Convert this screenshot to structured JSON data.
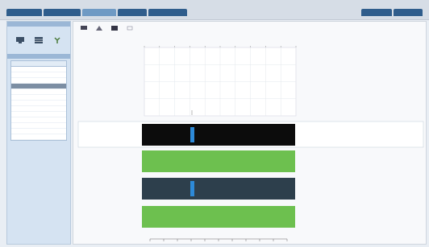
{
  "topbar": {
    "tabs": [
      "",
      "",
      "",
      "",
      ""
    ],
    "right_tabs": [
      "",
      ""
    ]
  },
  "sidebar": {
    "tools_header": "",
    "tools": [
      {
        "icon": "monitor-icon",
        "label": ""
      },
      {
        "icon": "grid-icon",
        "label": ""
      },
      {
        "icon": "tree-icon",
        "label": ""
      }
    ],
    "list_header": "",
    "table_headers": [
      "",
      ""
    ],
    "rows": [
      [
        "",
        ""
      ],
      [
        "",
        ""
      ],
      [
        "",
        ""
      ],
      [
        "",
        ""
      ],
      [
        "",
        ""
      ],
      [
        "",
        ""
      ],
      [
        "",
        ""
      ],
      [
        "",
        ""
      ],
      [
        "",
        ""
      ],
      [
        "",
        ""
      ],
      [
        "",
        ""
      ],
      [
        "",
        ""
      ],
      [
        "",
        ""
      ]
    ],
    "selected_row": 3
  },
  "main": {
    "toolbar": [
      {
        "icon": "display-icon",
        "label": ""
      },
      {
        "icon": "triangle-icon",
        "label": ""
      },
      {
        "icon": "chart-icon",
        "label": ""
      },
      {
        "icon": "options-icon",
        "label": ""
      }
    ],
    "lanes": [
      {
        "label": "",
        "color": "#0c0c0c",
        "marker": true
      },
      {
        "label": "",
        "color": "#6dc04f",
        "marker": false
      },
      {
        "label": "",
        "color": "#2d3f4c",
        "marker": true
      },
      {
        "label": "",
        "color": "#6dc04f",
        "marker": false
      }
    ],
    "marker_color": "#2d8ad8",
    "selected_lane_highlight": "#ffffff"
  }
}
